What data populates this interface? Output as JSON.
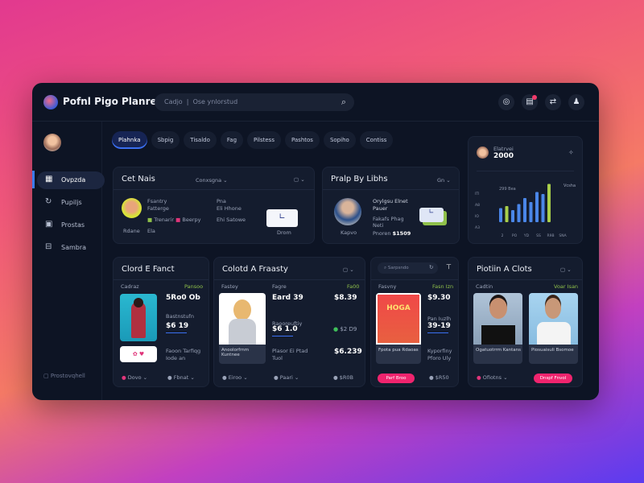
{
  "header": {
    "title": "Pofnl Pigo Planret",
    "search_label": "Cadjo",
    "search_placeholder": "Ose ynlorstud",
    "icons": [
      "search-icon",
      "globe-icon",
      "message-icon",
      "transfer-icon",
      "user-icon"
    ]
  },
  "sidebar": {
    "items": [
      {
        "label": "Ovpzda",
        "icon": "grid-icon"
      },
      {
        "label": "Pupiljs",
        "icon": "refresh-icon"
      },
      {
        "label": "Prostas",
        "icon": "calendar-icon"
      },
      {
        "label": "Sambra",
        "icon": "briefcase-icon"
      }
    ],
    "footer": "Prostovqhell"
  },
  "tabs": [
    "Plahnka",
    "Sbpig",
    "Tisaldo",
    "Fag",
    "Pilstess",
    "Pashtos",
    "Sopiho",
    "Contiss"
  ],
  "card_a": {
    "title": "Cet Nais",
    "dropdown": "Conxsgna",
    "name1": "Fsantry",
    "name2": "Fatterge",
    "tag1": "Trenarir",
    "tag2": "Beerpy",
    "col1": "Pna",
    "col2": "Eli Hhone",
    "col3": "Ehi Satowe",
    "label1": "Rdane",
    "label2": "Ela",
    "button": "Drom"
  },
  "card_b": {
    "title": "Pralp By Libhs",
    "dropdown": "Gn",
    "line1": "Orylgsu Elnet",
    "line2": "Pauer",
    "sub": "Fakafs Phag",
    "sub2": "Neti",
    "price_label": "Pnoren",
    "price": "$1509",
    "caption": "Kapvo"
  },
  "chart_card": {
    "label": "Elatrvei",
    "value": "2000",
    "legend": "Vcsha",
    "inner": "299 Bea",
    "yticks": [
      "ITI",
      "A8",
      "IO",
      "A3"
    ],
    "xticks": [
      "2",
      "PO",
      "YD",
      "SS",
      "R9B",
      "SNA"
    ]
  },
  "chart_data": {
    "type": "bar",
    "values": [
      35,
      40,
      30,
      45,
      60,
      50,
      75,
      70,
      95
    ],
    "colors": [
      "#4a86e8",
      "#a9cf4a",
      "#4a86e8",
      "#4a86e8",
      "#4a86e8",
      "#4a86e8",
      "#4a86e8",
      "#4a86e8",
      "#a9cf4a"
    ],
    "ylim": [
      0,
      100
    ]
  },
  "card1": {
    "title": "Clord E Fanct",
    "label": "Cadraz",
    "tag": "Pansoo",
    "price1": "5Ro0 Ob",
    "price2": "$6 19",
    "sub2": "Bastnstufn",
    "desc": "Faoon Tarfiqg",
    "desc2": "Iode an",
    "f1": "Dovo",
    "f2": "Fbnat"
  },
  "card2": {
    "title": "Colotd A Fraasty",
    "label": "Fastey",
    "label2": "Fagre",
    "tag": "Fa00",
    "price1": "Eard 39",
    "price2": "$8.39",
    "price3": "$6 1.0",
    "price4": "$2 D9",
    "price5": "$6.239",
    "sub": "Raooreuftiy",
    "caption": "Anoolorfrnm Kuntnee",
    "desc": "Plasor Ei Ptad",
    "desc2": "Tuol",
    "f1": "Eiroo",
    "f2": "Paari",
    "f3": "$R0B"
  },
  "card3": {
    "search": "Sarpsndo",
    "label": "Fasvny",
    "tag": "Fasn Izn",
    "price1": "$9.30",
    "price2": "39-19",
    "sub": "Pan Iuzlh",
    "poster": "HOGA",
    "caption": "Fpota pua Rdaoas",
    "desc": "Kyporfiny",
    "desc2": "Pforo Uly",
    "button": "Parf Broo",
    "f1": "$R50"
  },
  "card4": {
    "title": "Piotiin A Clots",
    "label": "Cadtin",
    "tag": "Voar Isan",
    "cap1": "Ogatuotrrm Kantans",
    "cap2": "Piosuaisuli Bsomoe",
    "f1": "Ofiotns",
    "button": "Dnspf Fnvol"
  }
}
